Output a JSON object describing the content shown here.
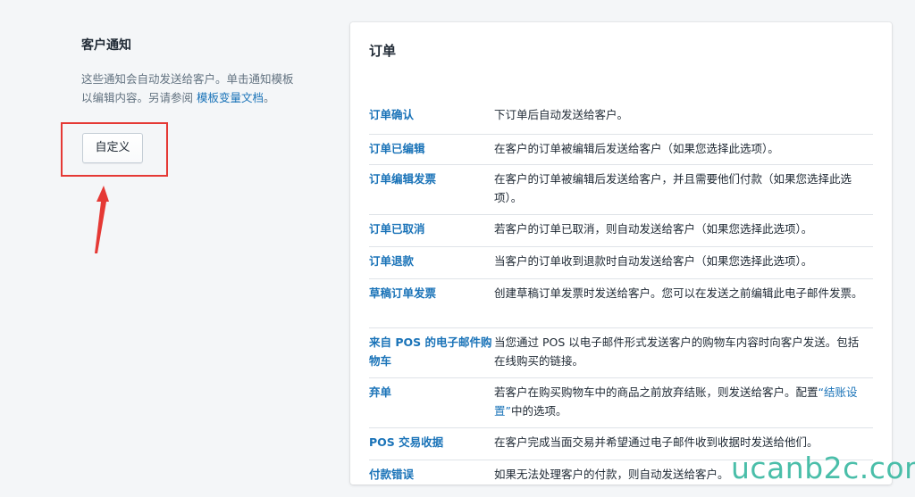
{
  "section": {
    "title": "客户通知",
    "description_prefix": "这些通知会自动发送给客户。单击通知模板以编辑内容。另请参阅 ",
    "description_link": "模板变量文档",
    "description_suffix": "。",
    "customize_label": "自定义"
  },
  "card": {
    "title": "订单",
    "rows": [
      {
        "name": "订单确认",
        "desc": "下订单后自动发送给客户。"
      },
      {
        "name": "订单已编辑",
        "desc": "在客户的订单被编辑后发送给客户（如果您选择此选项）。"
      },
      {
        "name": "订单编辑发票",
        "desc": "在客户的订单被编辑后发送给客户，并且需要他们付款（如果您选择此选项）。"
      },
      {
        "name": "订单已取消",
        "desc": "若客户的订单已取消，则自动发送给客户（如果您选择此选项）。"
      },
      {
        "name": "订单退款",
        "desc": "当客户的订单收到退款时自动发送给客户（如果您选择此选项）。"
      },
      {
        "name": "草稿订单发票",
        "desc": "创建草稿订单发票时发送给客户。您可以在发送之前编辑此电子邮件发票。"
      },
      {
        "name": "来自 POS 的电子邮件购物车",
        "desc": "当您通过 POS 以电子邮件形式发送客户的购物车内容时向客户发送。包括在线购买的链接。"
      },
      {
        "name": "弃单",
        "desc_prefix": "若客户在购买购物车中的商品之前放弃结账，则发送给客户。配置",
        "desc_link": "“结账设置”",
        "desc_suffix": "中的选项。"
      },
      {
        "name": "POS 交易收据",
        "desc": "在客户完成当面交易并希望通过电子邮件收到收据时发送给他们。"
      },
      {
        "name": "付款错误",
        "desc": "如果无法处理客户的付款，则自动发送给客户。"
      }
    ]
  },
  "watermark": "ucanb2c.com",
  "colors": {
    "link": "#1a73b8",
    "highlight": "#e53935",
    "watermark": "#37b7a0"
  }
}
